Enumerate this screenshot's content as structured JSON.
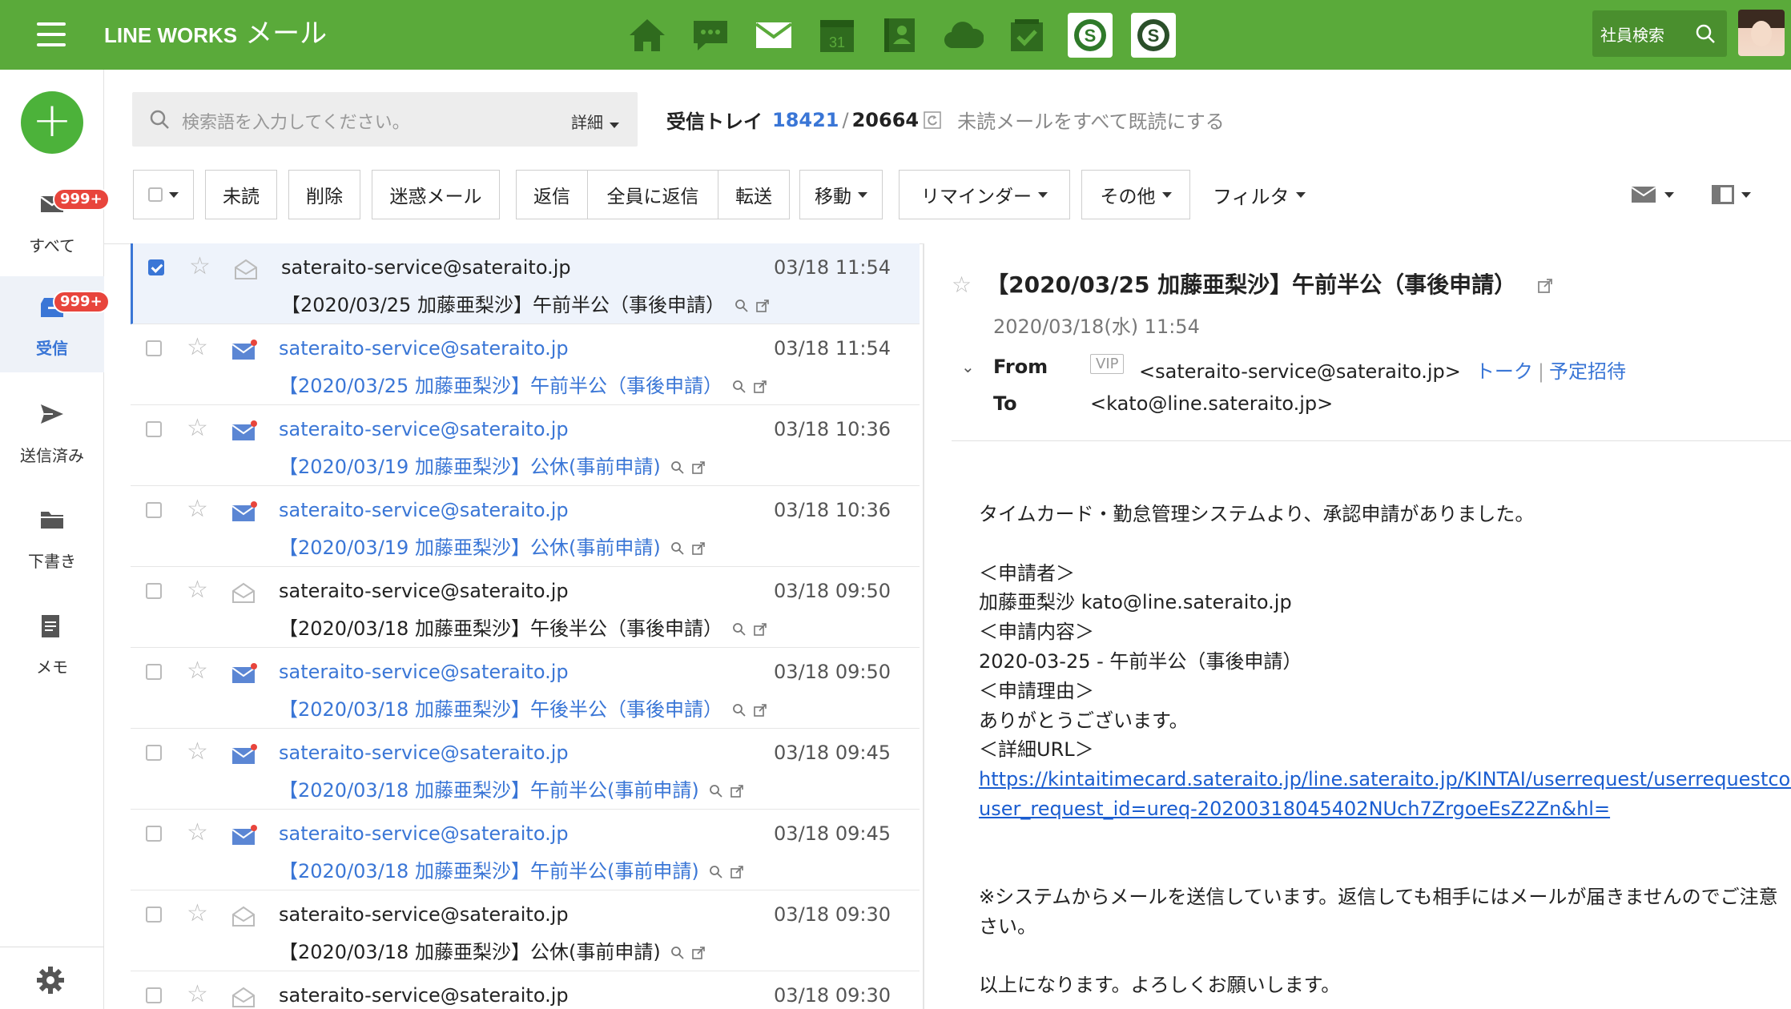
{
  "app": {
    "brand": "LINE WORKS",
    "module": "メール",
    "search_employee": "社員検索"
  },
  "colors": {
    "brand_green": "#5aaa3a",
    "accent_blue": "#3a76d6",
    "badge_red": "#e8453c"
  },
  "top_apps": [
    "home-icon",
    "chat-icon",
    "mail-icon",
    "calendar-icon",
    "contacts-icon",
    "drive-icon",
    "task-icon",
    "sateraito-app-icon",
    "sateraito-app-icon-2"
  ],
  "calendar_day": "31",
  "sidebar": {
    "items": [
      {
        "label": "すべて",
        "badge": "999+",
        "icon": "mail-icon"
      },
      {
        "label": "受信",
        "badge": "999+",
        "icon": "inbox-icon"
      },
      {
        "label": "送信済み",
        "icon": "send-icon"
      },
      {
        "label": "下書き",
        "icon": "folder-icon"
      },
      {
        "label": "メモ",
        "icon": "memo-icon"
      }
    ]
  },
  "search": {
    "placeholder": "検索語を入力してください。",
    "detail": "詳細"
  },
  "folder": {
    "name": "受信トレイ",
    "unread": "18421",
    "total": "20664",
    "mark_all": "未読メールをすべて既読にする"
  },
  "toolbar": {
    "unread": "未読",
    "delete": "削除",
    "spam": "迷惑メール",
    "reply": "返信",
    "reply_all": "全員に返信",
    "forward": "転送",
    "move": "移動",
    "reminder": "リマインダー",
    "other": "その他",
    "filter": "フィルタ"
  },
  "emails": [
    {
      "sender": "sateraito-service@sateraito.jp",
      "subject": "【2020/03/25 加藤亜梨沙】午前半公（事後申請）",
      "date": "03/18 11:54",
      "unread": false,
      "selected": true
    },
    {
      "sender": "sateraito-service@sateraito.jp",
      "subject": "【2020/03/25 加藤亜梨沙】午前半公（事後申請）",
      "date": "03/18 11:54",
      "unread": true
    },
    {
      "sender": "sateraito-service@sateraito.jp",
      "subject": "【2020/03/19 加藤亜梨沙】公休(事前申請)",
      "date": "03/18 10:36",
      "unread": true
    },
    {
      "sender": "sateraito-service@sateraito.jp",
      "subject": "【2020/03/19 加藤亜梨沙】公休(事前申請)",
      "date": "03/18 10:36",
      "unread": true
    },
    {
      "sender": "sateraito-service@sateraito.jp",
      "subject": "【2020/03/18 加藤亜梨沙】午後半公（事後申請）",
      "date": "03/18 09:50",
      "unread": false
    },
    {
      "sender": "sateraito-service@sateraito.jp",
      "subject": "【2020/03/18 加藤亜梨沙】午後半公（事後申請）",
      "date": "03/18 09:50",
      "unread": true
    },
    {
      "sender": "sateraito-service@sateraito.jp",
      "subject": "【2020/03/18 加藤亜梨沙】午前半公(事前申請)",
      "date": "03/18 09:45",
      "unread": true
    },
    {
      "sender": "sateraito-service@sateraito.jp",
      "subject": "【2020/03/18 加藤亜梨沙】午前半公(事前申請)",
      "date": "03/18 09:45",
      "unread": true
    },
    {
      "sender": "sateraito-service@sateraito.jp",
      "subject": "【2020/03/18 加藤亜梨沙】公休(事前申請)",
      "date": "03/18 09:30",
      "unread": false
    },
    {
      "sender": "sateraito-service@sateraito.jp",
      "subject": "",
      "date": "03/18 09:30",
      "unread": false
    }
  ],
  "reader": {
    "title": "【2020/03/25 加藤亜梨沙】午前半公（事後申請）",
    "date": "2020/03/18(水) 11:54",
    "from_label": "From",
    "vip": "VIP",
    "from": "<sateraito-service@sateraito.jp>",
    "talk": "トーク",
    "invite": "予定招待",
    "to_label": "To",
    "to": "<kato@line.sateraito.jp>",
    "body": [
      "タイムカード・勤怠管理システムより、承認申請がありました。",
      "",
      "＜申請者＞",
      "加藤亜梨沙 kato@line.sateraito.jp",
      "＜申請内容＞",
      "2020-03-25 - 午前半公（事後申請）",
      "＜申請理由＞",
      "ありがとうございます。",
      "＜詳細URL＞"
    ],
    "url_line1": "https://kintaitimecard.sateraito.jp/line.sateraito.jp/KINTAI/userrequest/userrequestconfirm?",
    "url_line2": "user_request_id=ureq-20200318045402NUch7ZrgoeEsZ2Zn&hl=",
    "notice_line1": "※システムからメールを送信しています。返信しても相手にはメールが届きませんのでご注意",
    "notice_line2": "さい。",
    "closing": "以上になります。よろしくお願いします。"
  }
}
